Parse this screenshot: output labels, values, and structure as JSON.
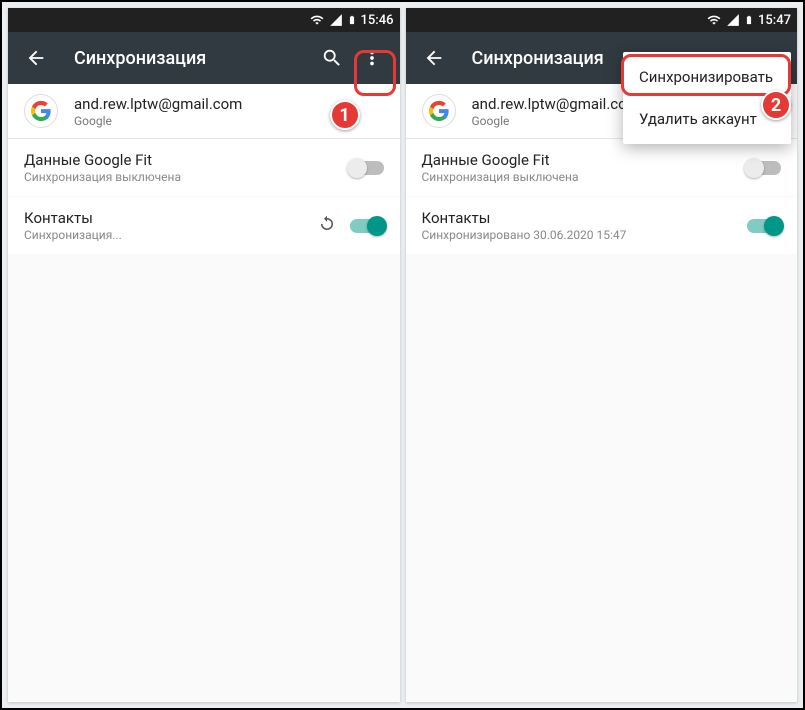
{
  "left": {
    "status_time": "15:46",
    "appbar_title": "Синхронизация",
    "account": {
      "email": "and.rew.lptw@gmail.com",
      "provider": "Google"
    },
    "items": [
      {
        "title": "Данные Google Fit",
        "sub": "Синхронизация выключена",
        "on": false,
        "syncing": false
      },
      {
        "title": "Контакты",
        "sub": "Синхронизация...",
        "on": true,
        "syncing": true
      }
    ],
    "badge": "1"
  },
  "right": {
    "status_time": "15:47",
    "appbar_title": "Синхронизация",
    "account": {
      "email": "and.rew.lptw@gmail.com",
      "provider": "Google"
    },
    "menu": {
      "sync_now": "Синхронизировать",
      "remove": "Удалить аккаунт"
    },
    "items": [
      {
        "title": "Данные Google Fit",
        "sub": "Синхронизация выключена",
        "on": false,
        "syncing": false
      },
      {
        "title": "Контакты",
        "sub": "Синхронизировано 30.06.2020 15:47",
        "on": true,
        "syncing": false
      }
    ],
    "badge": "2"
  }
}
